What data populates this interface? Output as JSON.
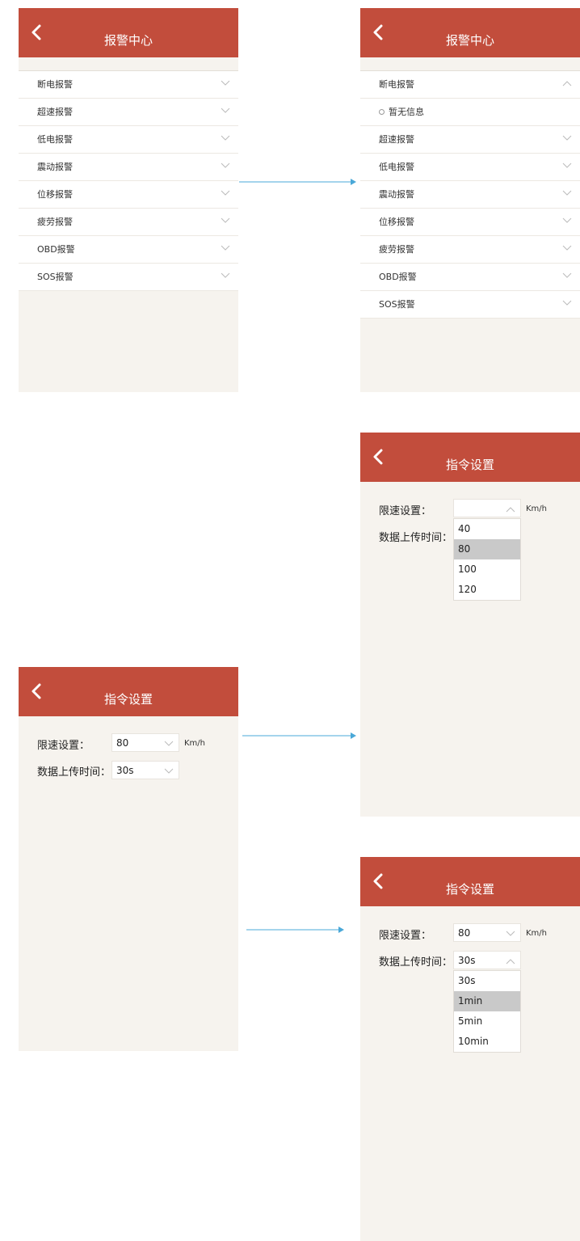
{
  "colors": {
    "header": "#c24d3c",
    "background": "#f6f3ee",
    "arrow": "#4aa8d8",
    "highlight": "#c9c9c9"
  },
  "alarm_screens": [
    {
      "title": "报警中心",
      "items": [
        {
          "label": "断电报警",
          "chevron": "chevron-down-icon"
        },
        {
          "label": "超速报警",
          "chevron": "chevron-down-icon"
        },
        {
          "label": "低电报警",
          "chevron": "chevron-down-icon"
        },
        {
          "label": "震动报警",
          "chevron": "chevron-down-icon"
        },
        {
          "label": "位移报警",
          "chevron": "chevron-down-icon"
        },
        {
          "label": "疲劳报警",
          "chevron": "chevron-down-icon"
        },
        {
          "label": "OBD报警",
          "chevron": "chevron-down-icon"
        },
        {
          "label": "SOS报警",
          "chevron": "chevron-down-icon"
        }
      ]
    },
    {
      "title": "报警中心",
      "items": [
        {
          "label": "断电报警",
          "chevron": "chevron-up-icon"
        },
        {
          "label": "暂无信息",
          "sub": true
        },
        {
          "label": "超速报警",
          "chevron": "chevron-down-icon"
        },
        {
          "label": "低电报警",
          "chevron": "chevron-down-icon"
        },
        {
          "label": "震动报警",
          "chevron": "chevron-down-icon"
        },
        {
          "label": "位移报警",
          "chevron": "chevron-down-icon"
        },
        {
          "label": "疲劳报警",
          "chevron": "chevron-down-icon"
        },
        {
          "label": "OBD报警",
          "chevron": "chevron-down-icon"
        },
        {
          "label": "SOS报警",
          "chevron": "chevron-down-icon"
        }
      ]
    }
  ],
  "command_screens": [
    {
      "title": "指令设置",
      "speed_label": "限速设置：",
      "speed_value": "",
      "speed_unit": "Km/h",
      "upload_label": "数据上传时间：",
      "speed_options": [
        "40",
        "80",
        "100",
        "120"
      ],
      "speed_highlight": "80"
    },
    {
      "title": "指令设置",
      "speed_label": "限速设置：",
      "speed_value": "80",
      "speed_unit": "Km/h",
      "upload_label": "数据上传时间：",
      "upload_value": "30s"
    },
    {
      "title": "指令设置",
      "speed_label": "限速设置：",
      "speed_value": "80",
      "speed_unit": "Km/h",
      "upload_label": "数据上传时间：",
      "upload_value": "30s",
      "upload_options": [
        "30s",
        "1min",
        "5min",
        "10min"
      ],
      "upload_highlight": "1min"
    }
  ]
}
